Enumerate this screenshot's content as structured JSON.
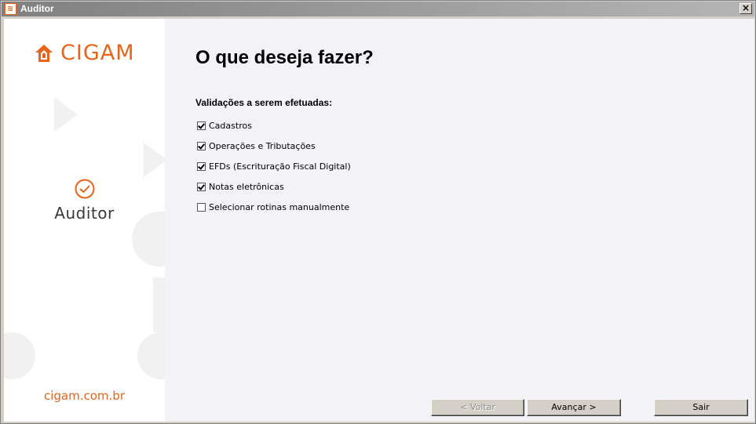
{
  "window": {
    "title": "Auditor",
    "app_icon_glyph": "≋",
    "close_glyph": "×"
  },
  "sidebar": {
    "brand": "CIGAM",
    "product": "Auditor",
    "website": "cigam.com.br",
    "brand_color": "#e8641b"
  },
  "main": {
    "heading": "O que deseja fazer?",
    "section_label": "Validações a serem efetuadas:",
    "options": [
      {
        "label": "Cadastros",
        "checked": true
      },
      {
        "label": "Operações e Tributações",
        "checked": true
      },
      {
        "label": "EFDs (Escrituração Fiscal Digital)",
        "checked": true
      },
      {
        "label": "Notas eletrônicas",
        "checked": true
      },
      {
        "label": "Selecionar rotinas manualmente",
        "checked": false
      }
    ]
  },
  "buttons": {
    "back": {
      "label": "< Voltar",
      "enabled": false
    },
    "next": {
      "label": "Avançar >",
      "enabled": true
    },
    "exit": {
      "label": "Sair",
      "enabled": true
    }
  }
}
